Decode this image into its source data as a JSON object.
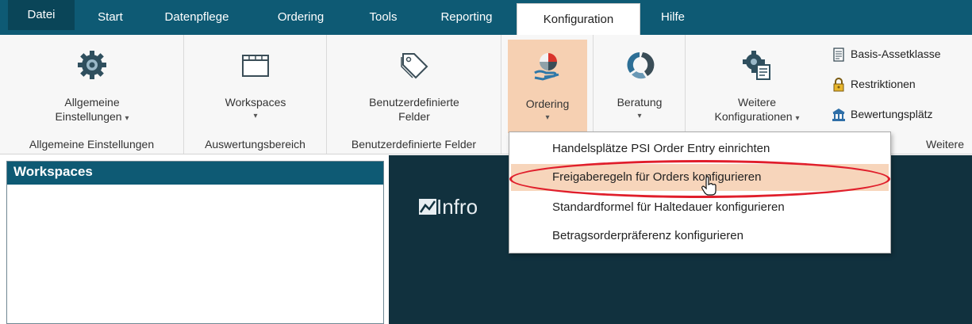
{
  "tabs": [
    "Datei",
    "Start",
    "Datenpflege",
    "Ordering",
    "Tools",
    "Reporting",
    "Konfiguration",
    "Hilfe"
  ],
  "active_tab": "Konfiguration",
  "ribbon": {
    "groups": [
      {
        "label": "Allgemeine Einstellungen",
        "button": {
          "line1": "Allgemeine",
          "line2": "Einstellungen",
          "caret": "▾",
          "icon": "gear-icon"
        }
      },
      {
        "label": "Auswertungsbereich",
        "button": {
          "line1": "Workspaces",
          "caret": "▾",
          "icon": "workspace-icon"
        }
      },
      {
        "label": "Benutzerdefinierte Felder",
        "button": {
          "line1": "Benutzerdefinierte",
          "line2": "Felder",
          "icon": "tag-icon"
        }
      },
      {
        "button": {
          "line1": "Ordering",
          "caret": "▾",
          "icon": "ordering-icon"
        }
      },
      {
        "button": {
          "line1": "Beratung",
          "caret": "▾",
          "icon": "beratung-icon"
        }
      },
      {
        "label": "Weitere",
        "button": {
          "line1": "Weitere",
          "line2": "Konfigurationen",
          "caret": "▾",
          "icon": "config-gear-icon"
        },
        "small_buttons": [
          {
            "label": "Basis-Assetklasse",
            "icon": "document-icon"
          },
          {
            "label": "Restriktionen",
            "icon": "lock-icon"
          },
          {
            "label": "Bewertungsplätz",
            "icon": "bank-icon"
          }
        ]
      }
    ]
  },
  "workspace_pane": {
    "title": "Workspaces"
  },
  "content": {
    "logo_text": "Infro"
  },
  "dropdown": {
    "items": [
      "Handelsplätze PSI Order Entry einrichten",
      "Freigaberegeln für Orders konfigurieren",
      "Standardformel für Haltedauer konfigurieren",
      "Betragsorderpräferenz konfigurieren"
    ],
    "hovered_index": 1
  }
}
